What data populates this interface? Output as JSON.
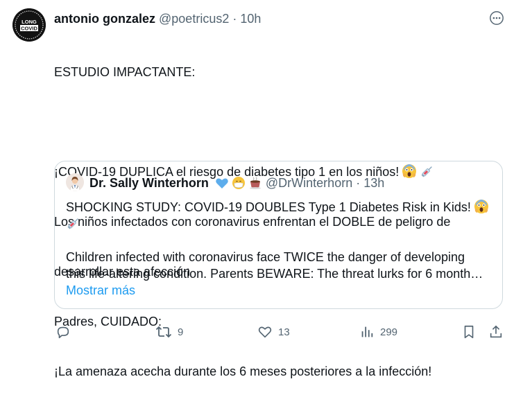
{
  "author": {
    "name": "antonio gonzalez",
    "handle": "@poetricus2",
    "separator": "·",
    "time": "10h",
    "avatar_text_top": "LONG",
    "avatar_text_bottom": "COVID"
  },
  "body_lines": [
    "ESTUDIO IMPACTANTE:",
    "",
    "¡COVID-19 DUPLICA el riesgo de diabetes tipo 1 en los niños!",
    " Los niños infectados con coronavirus enfrentan el DOBLE de peligro de",
    "desarrollar esta afección",
    " Padres, CUIDADO:",
    " ¡La amenaza acecha durante los 6 meses posteriores a la infección!"
  ],
  "quote": {
    "name": "Dr. Sally Winterhorn",
    "handle": "@DrWinterhorn",
    "separator": "·",
    "time": "13h",
    "line1": "SHOCKING STUDY: COVID-19 DOUBLES Type 1 Diabetes Risk in Kids!",
    "line2": "",
    "line3": "Children infected with coronavirus face TWICE the danger of developing",
    "line4": "this life-altering condition. Parents BEWARE: The threat lurks for 6 month…",
    "show_more": "Mostrar más"
  },
  "actions": {
    "reply_count": "",
    "retweet_count": "9",
    "like_count": "13",
    "views_count": "299"
  },
  "colors": {
    "text": "#0f1419",
    "secondary": "#536471",
    "link": "#1d9bf0",
    "border": "#cfd9de"
  }
}
